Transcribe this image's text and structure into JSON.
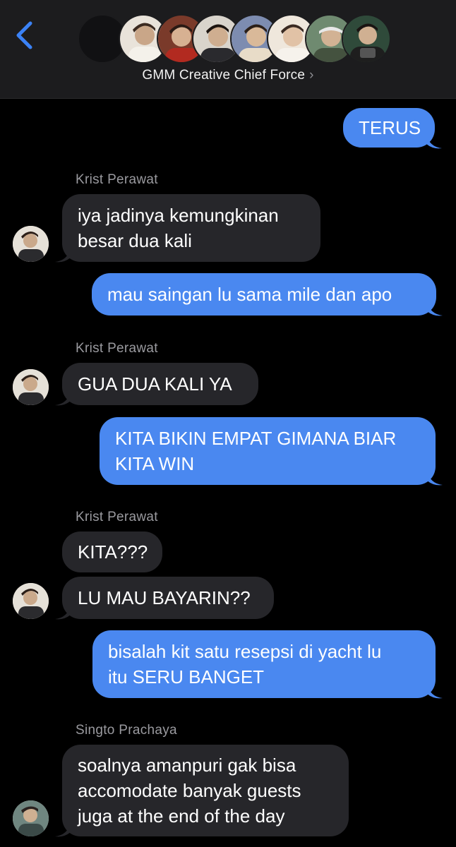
{
  "header": {
    "back_label": "",
    "group_name": "GMM Creative Chief Force",
    "chevron": "›"
  },
  "messages": [
    {
      "text": "TERUS"
    },
    {
      "sender": "Krist Perawat",
      "text_lines": [
        "iya jadinya kemungkinan",
        "besar dua kali"
      ]
    },
    {
      "text": "mau saingan lu sama mile dan apo"
    },
    {
      "sender": "Krist Perawat",
      "text": "GUA DUA KALI YA"
    },
    {
      "text_lines": [
        "KITA BIKIN EMPAT GIMANA BIAR",
        "KITA WIN"
      ]
    },
    {
      "sender": "Krist Perawat",
      "text": "KITA???"
    },
    {
      "text": "LU MAU BAYARIN??"
    },
    {
      "text_lines": [
        "bisalah kit satu resepsi di yacht lu",
        "itu SERU BANGET"
      ]
    },
    {
      "sender": "Singto Prachaya",
      "text_lines": [
        "soalnya amanpuri gak bisa",
        "accomodate banyak guests",
        "juga at the end of the day"
      ]
    }
  ],
  "colors": {
    "outgoing_bubble": "#4a88f0",
    "incoming_bubble": "#26262a",
    "header_bg": "#1c1c1e",
    "accent": "#3b82f6"
  },
  "icons": {
    "back": "chevron-left-icon",
    "group_chevron": "chevron-right-icon"
  }
}
